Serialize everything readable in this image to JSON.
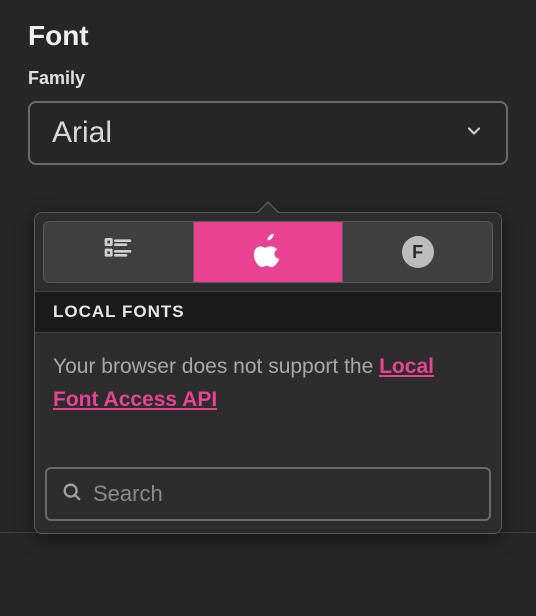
{
  "section": {
    "title": "Font"
  },
  "family": {
    "label": "Family",
    "selected": "Arial"
  },
  "popover": {
    "tabs": [
      {
        "id": "list",
        "icon": "list-icon",
        "active": false
      },
      {
        "id": "system",
        "icon": "apple-icon",
        "active": true
      },
      {
        "id": "google",
        "icon": "font-badge-icon",
        "active": false
      }
    ],
    "localFonts": {
      "header": "LOCAL FONTS",
      "message_prefix": "Your browser does not support the ",
      "api_link_text": "Local Font Access API"
    },
    "search": {
      "placeholder": "Search",
      "value": ""
    }
  },
  "colors": {
    "accent": "#e84393"
  }
}
